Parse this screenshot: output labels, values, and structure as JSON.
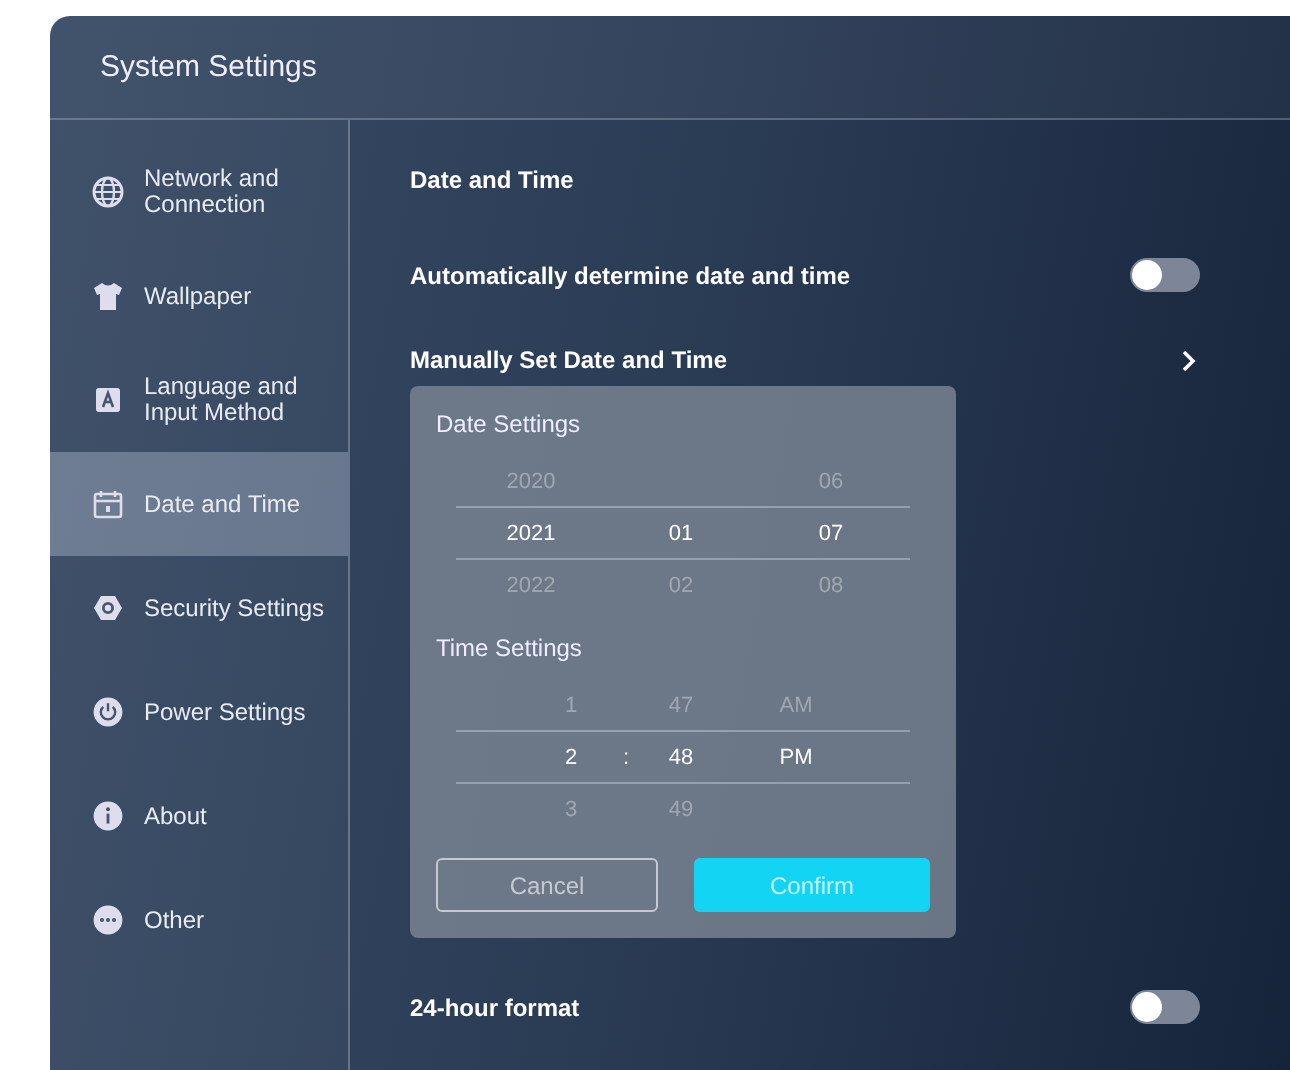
{
  "window": {
    "title": "System Settings"
  },
  "sidebar": {
    "items": [
      {
        "label": "Network and Connection",
        "selected": false
      },
      {
        "label": "Wallpaper",
        "selected": false
      },
      {
        "label": "Language and Input Method",
        "selected": false
      },
      {
        "label": "Date and Time",
        "selected": true
      },
      {
        "label": "Security Settings",
        "selected": false
      },
      {
        "label": "Power Settings",
        "selected": false
      },
      {
        "label": "About",
        "selected": false
      },
      {
        "label": "Other",
        "selected": false
      }
    ]
  },
  "content": {
    "heading": "Date and Time",
    "rows": [
      {
        "kind": "toggle",
        "label": "Automatically determine date and time",
        "on": false
      },
      {
        "kind": "link",
        "label": "Manually Set Date and Time"
      },
      {
        "kind": "dialog",
        "sections": [
          {
            "title": "Date Settings",
            "columns": [
              {
                "kind": "number",
                "above": "2020",
                "value": "2021",
                "below": "2022"
              },
              {
                "kind": "number",
                "value": "01",
                "below": "02"
              },
              {
                "kind": "number",
                "above": "06",
                "value": "07",
                "below": "08"
              }
            ]
          },
          {
            "title": "Time Settings",
            "columns": [
              {
                "kind": "hour",
                "above": "1",
                "value": "2",
                "below": "3"
              },
              {
                "kind": "separator",
                "value": ":"
              },
              {
                "kind": "minute",
                "above": "47",
                "value": "48",
                "below": "49"
              },
              {
                "kind": "period",
                "above": "AM",
                "value": "PM"
              }
            ]
          }
        ],
        "buttons": [
          {
            "kind": "secondary",
            "label": "Cancel"
          },
          {
            "kind": "primary",
            "label": "Confirm"
          }
        ]
      },
      {
        "kind": "toggle",
        "label": "24-hour format",
        "on": false
      }
    ]
  }
}
